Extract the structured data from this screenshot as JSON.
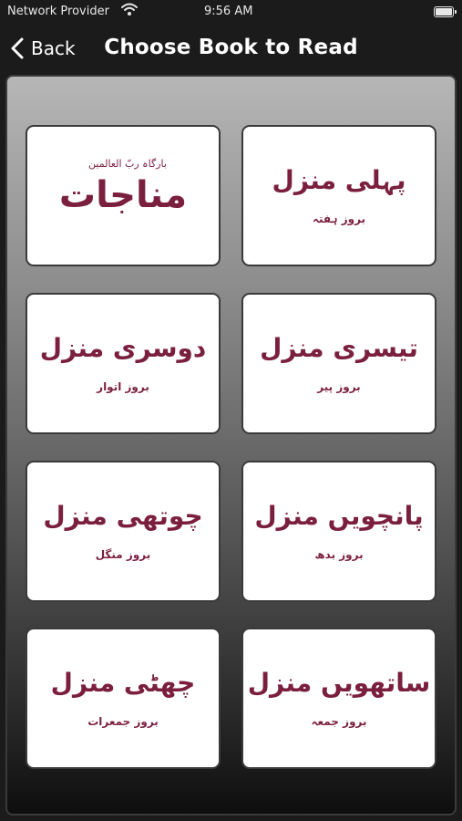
{
  "status_bar": {
    "carrier": "Network Provider",
    "wifi_icon": "wifi-icon",
    "time": "9:56 AM",
    "battery_icon": "battery-icon"
  },
  "nav": {
    "back_icon": "chevron-left-icon",
    "back_label": "Back",
    "title": "Choose Book to Read"
  },
  "colors": {
    "text_accent": "#7b1f3f",
    "nav_background": "#1b1b1b",
    "card_background": "#ffffff"
  },
  "books": [
    {
      "title": "مناجات",
      "overline": "بارگاہ ربّ العالمین"
    },
    {
      "title": "پہلی منزل",
      "subtitle": "بروز ہفتہ"
    },
    {
      "title": "دوسری منزل",
      "subtitle": "بروز اتوار"
    },
    {
      "title": "تیسری منزل",
      "subtitle": "بروز پیر"
    },
    {
      "title": "چوتھی منزل",
      "subtitle": "بروز منگل"
    },
    {
      "title": "پانچویں منزل",
      "subtitle": "بروز بدھ"
    },
    {
      "title": "چھٹی منزل",
      "subtitle": "بروز جمعرات"
    },
    {
      "title": "ساتھویں منزل",
      "subtitle": "بروز جمعہ"
    }
  ]
}
